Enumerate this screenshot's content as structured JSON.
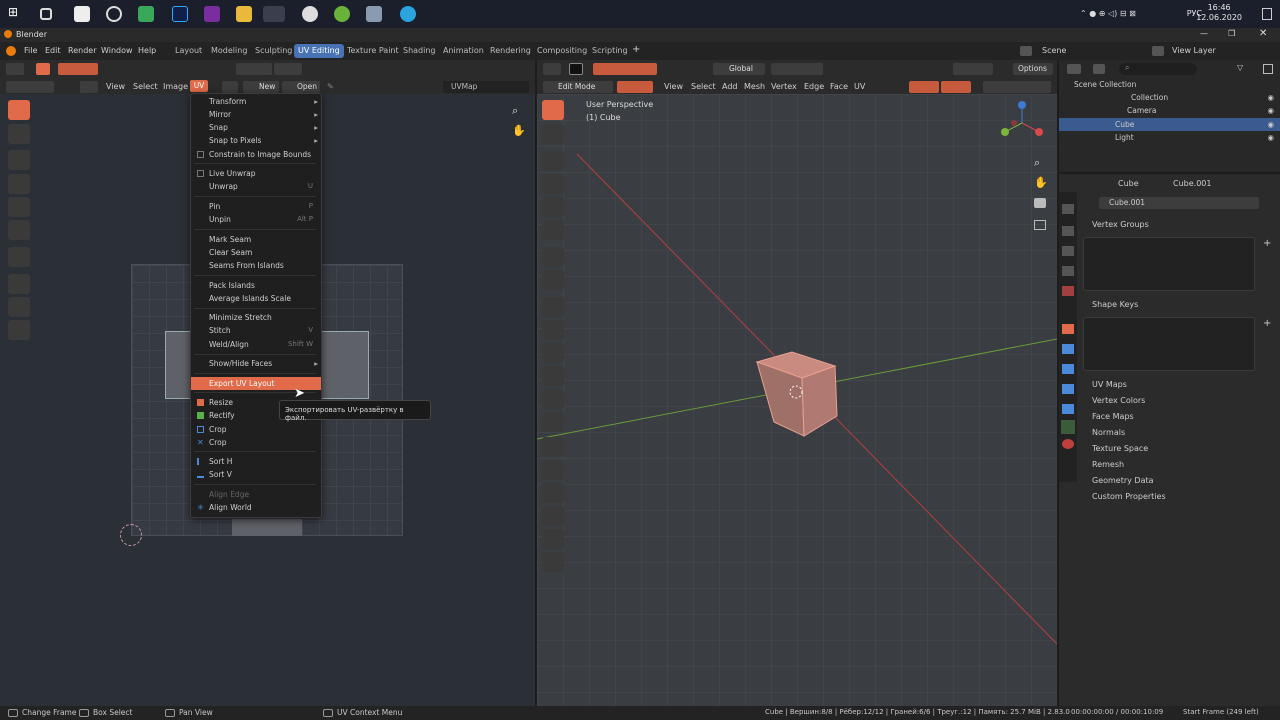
{
  "taskbar": {
    "lang": "РУС",
    "time": "16:46",
    "date": "12.06.2020"
  },
  "window": {
    "title": "Blender"
  },
  "menubar": {
    "items": [
      "File",
      "Edit",
      "Render",
      "Window",
      "Help"
    ],
    "workspaces": [
      "Layout",
      "Modeling",
      "Sculpting",
      "UV Editing",
      "Texture Paint",
      "Shading",
      "Animation",
      "Rendering",
      "Compositing",
      "Scripting"
    ],
    "active_workspace": "UV Editing",
    "scene": "Scene",
    "view_layer": "View Layer"
  },
  "uv_editor": {
    "header_items": [
      "View",
      "Select",
      "Image",
      "UV"
    ],
    "new_label": "New",
    "open_label": "Open",
    "uvmap": "UVMap"
  },
  "uv_menu": {
    "items": [
      {
        "label": "Transform",
        "shortcut": "",
        "submenu": true
      },
      {
        "label": "Mirror",
        "shortcut": "",
        "submenu": true
      },
      {
        "label": "Snap",
        "shortcut": "",
        "submenu": true
      },
      {
        "label": "Snap to Pixels",
        "shortcut": "",
        "submenu": true
      },
      {
        "label": "Constrain to Image Bounds",
        "shortcut": "",
        "checkbox": true
      },
      {
        "label": "Live Unwrap",
        "shortcut": "",
        "checkbox": true
      },
      {
        "label": "Unwrap",
        "shortcut": "U"
      },
      {
        "label": "Pin",
        "shortcut": "P"
      },
      {
        "label": "Unpin",
        "shortcut": "Alt P"
      },
      {
        "label": "Mark Seam",
        "shortcut": ""
      },
      {
        "label": "Clear Seam",
        "shortcut": ""
      },
      {
        "label": "Seams From Islands",
        "shortcut": ""
      },
      {
        "label": "Pack Islands",
        "shortcut": ""
      },
      {
        "label": "Average Islands Scale",
        "shortcut": ""
      },
      {
        "label": "Minimize Stretch",
        "shortcut": ""
      },
      {
        "label": "Stitch",
        "shortcut": "V"
      },
      {
        "label": "Weld/Align",
        "shortcut": "Shift W"
      },
      {
        "label": "Show/Hide Faces",
        "shortcut": "",
        "submenu": true
      },
      {
        "label": "Export UV Layout",
        "shortcut": "",
        "highlighted": true
      },
      {
        "label": "Resize",
        "shortcut": ""
      },
      {
        "label": "Rectify",
        "shortcut": ""
      },
      {
        "label": "Crop",
        "shortcut": ""
      },
      {
        "label": "Crop",
        "shortcut": ""
      },
      {
        "label": "Sort H",
        "shortcut": ""
      },
      {
        "label": "Sort V",
        "shortcut": ""
      },
      {
        "label": "Align Edge",
        "shortcut": "",
        "disabled": true
      },
      {
        "label": "Align World",
        "shortcut": ""
      }
    ],
    "tooltip": "Экспортировать UV-развёртку в файл."
  },
  "viewport": {
    "mode": "Edit Mode",
    "header_items": [
      "View",
      "Select",
      "Add",
      "Mesh",
      "Vertex",
      "Edge",
      "Face",
      "UV"
    ],
    "orientation": "Global",
    "options": "Options",
    "perspective": "User Perspective",
    "object": "(1) Cube"
  },
  "outliner": {
    "root": "Scene Collection",
    "collection": "Collection",
    "objects": [
      "Camera",
      "Cube",
      "Light"
    ],
    "selected": "Cube"
  },
  "properties": {
    "object": "Cube",
    "mesh": "Cube.001",
    "mesh_field": "Cube.001",
    "vertex_groups": "Vertex Groups",
    "shape_keys": "Shape Keys",
    "sections": [
      "UV Maps",
      "Vertex Colors",
      "Face Maps",
      "Normals",
      "Texture Space",
      "Remesh",
      "Geometry Data",
      "Custom Properties"
    ]
  },
  "statusbar": {
    "change_frame": "Change Frame",
    "box_select": "Box Select",
    "pan_view": "Pan View",
    "context_menu": "UV Context Menu",
    "stats": "Cube | Вершин:8/8 | Рёбер:12/12 | Граней:6/6 | Треуг.:12 | Память: 25.7 MiB | 2.83.0",
    "time": "00:00:00:00 / 00:00:10:09",
    "start_frame": "Start Frame (249 left)"
  },
  "colors": {
    "accent": "#e06a4a",
    "active_ws": "#4772b3",
    "selected_row": "#3b5b8f"
  }
}
